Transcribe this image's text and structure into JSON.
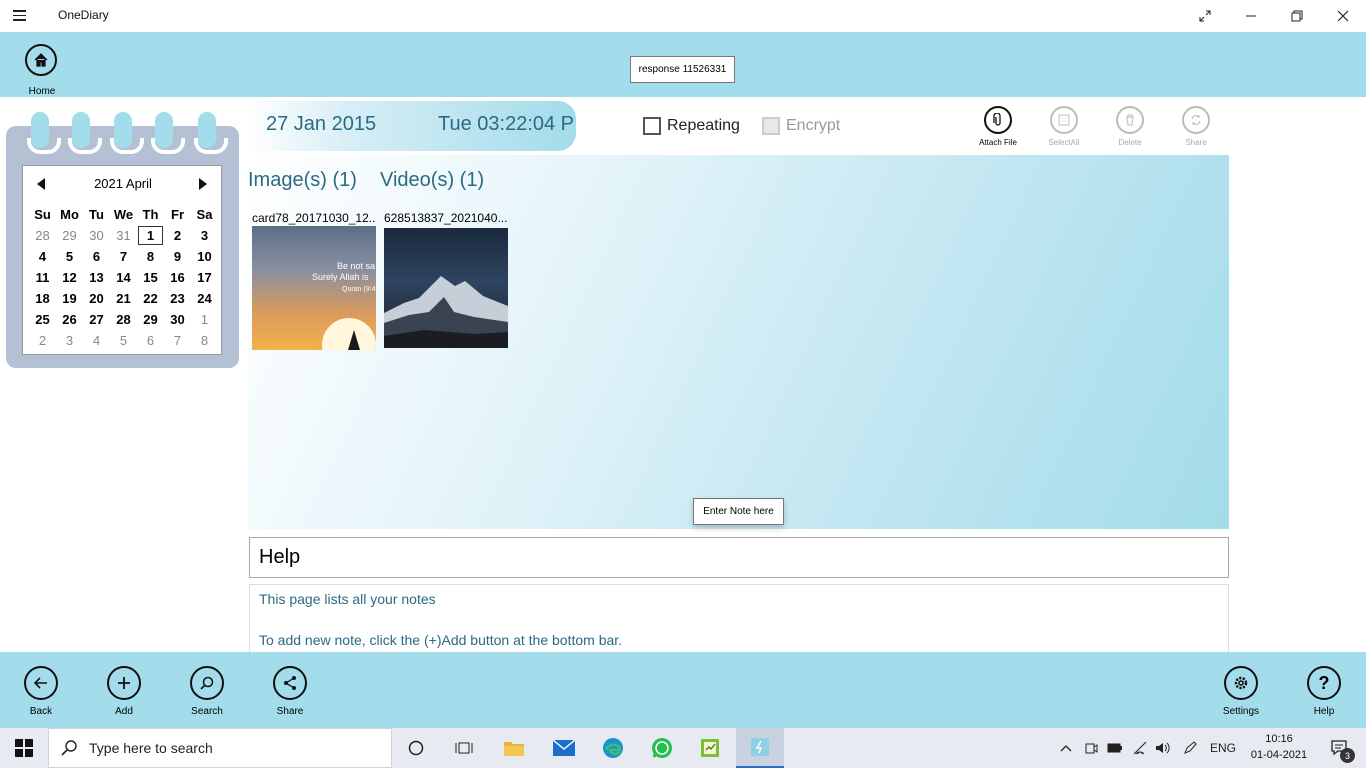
{
  "window": {
    "title": "OneDiary"
  },
  "topbar": {
    "home_label": "Home",
    "response_tooltip": "response 11526331"
  },
  "calendar": {
    "month_title": "2021 April",
    "day_headers": [
      "Su",
      "Mo",
      "Tu",
      "We",
      "Th",
      "Fr",
      "Sa"
    ],
    "weeks": [
      [
        "28",
        "29",
        "30",
        "31",
        "1",
        "2",
        "3"
      ],
      [
        "4",
        "5",
        "6",
        "7",
        "8",
        "9",
        "10"
      ],
      [
        "11",
        "12",
        "13",
        "14",
        "15",
        "16",
        "17"
      ],
      [
        "18",
        "19",
        "20",
        "21",
        "22",
        "23",
        "24"
      ],
      [
        "25",
        "26",
        "27",
        "28",
        "29",
        "30",
        "1"
      ],
      [
        "2",
        "3",
        "4",
        "5",
        "6",
        "7",
        "8"
      ]
    ],
    "today": "1"
  },
  "entry": {
    "date": "27  Jan 2015",
    "time": "Tue 03:22:04 P",
    "repeating_label": "Repeating",
    "encrypt_label": "Encrypt",
    "title_value": "Help"
  },
  "toolbar": {
    "attach": "Attach File",
    "select_all": "SelectAll",
    "delete": "Delete",
    "share": "Share"
  },
  "media": {
    "images_tab": "Image(s) (1)",
    "videos_tab": "Video(s) (1)",
    "image_name": "card78_20171030_12...",
    "video_name": "628513837_2021040...",
    "image_caption_line1": "Be not sa",
    "image_caption_line2": "Surely Allah is",
    "image_caption_line3": "Quran (9:4"
  },
  "note": {
    "tooltip": "Enter Note here",
    "line1": "This page lists all your notes",
    "line2": "To add new note, click the (+)Add button at the bottom bar."
  },
  "bottombar": {
    "back": "Back",
    "add": "Add",
    "search": "Search",
    "share": "Share",
    "settings": "Settings",
    "help": "Help"
  },
  "taskbar": {
    "search_placeholder": "Type here to search",
    "language": "ENG",
    "time": "10:16",
    "date": "01-04-2021",
    "notification_count": "3"
  },
  "colors": {
    "accent_blue": "#a3dcea",
    "text_teal": "#2a6b82",
    "calendar_frame": "#b4c0d3"
  }
}
